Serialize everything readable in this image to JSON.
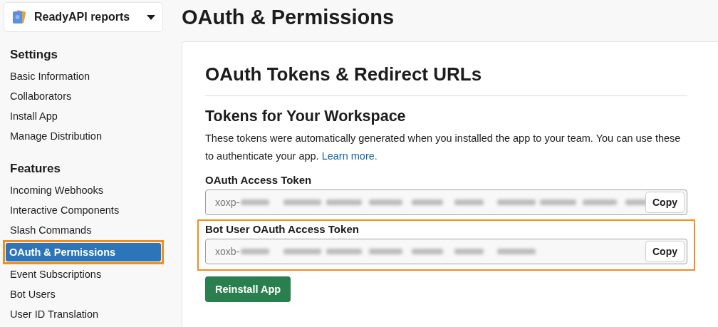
{
  "workspace": {
    "name": "ReadyAPI reports"
  },
  "sidebar": {
    "sections": [
      {
        "title": "Settings",
        "items": [
          {
            "label": "Basic Information",
            "selected": false,
            "highlighted": false
          },
          {
            "label": "Collaborators",
            "selected": false,
            "highlighted": false
          },
          {
            "label": "Install App",
            "selected": false,
            "highlighted": false
          },
          {
            "label": "Manage Distribution",
            "selected": false,
            "highlighted": false
          }
        ]
      },
      {
        "title": "Features",
        "items": [
          {
            "label": "Incoming Webhooks",
            "selected": false,
            "highlighted": false
          },
          {
            "label": "Interactive Components",
            "selected": false,
            "highlighted": false
          },
          {
            "label": "Slash Commands",
            "selected": false,
            "highlighted": false
          },
          {
            "label": "OAuth & Permissions",
            "selected": true,
            "highlighted": true
          },
          {
            "label": "Event Subscriptions",
            "selected": false,
            "highlighted": false
          },
          {
            "label": "Bot Users",
            "selected": false,
            "highlighted": false
          },
          {
            "label": "User ID Translation",
            "selected": false,
            "highlighted": false
          }
        ]
      }
    ]
  },
  "page_title": "OAuth & Permissions",
  "card": {
    "title": "OAuth Tokens & Redirect URLs",
    "subtitle": "Tokens for Your Workspace",
    "description": "These tokens were automatically generated when you installed the app to your team. You can use these to authenticate your app.",
    "link": "Learn more.",
    "tokens": [
      {
        "label": "OAuth Access Token",
        "prefix": "xoxp-",
        "button": "Copy",
        "highlighted": false
      },
      {
        "label": "Bot User OAuth Access Token",
        "prefix": "xoxb-",
        "button": "Copy",
        "highlighted": true
      }
    ],
    "action": "Reinstall App"
  }
}
